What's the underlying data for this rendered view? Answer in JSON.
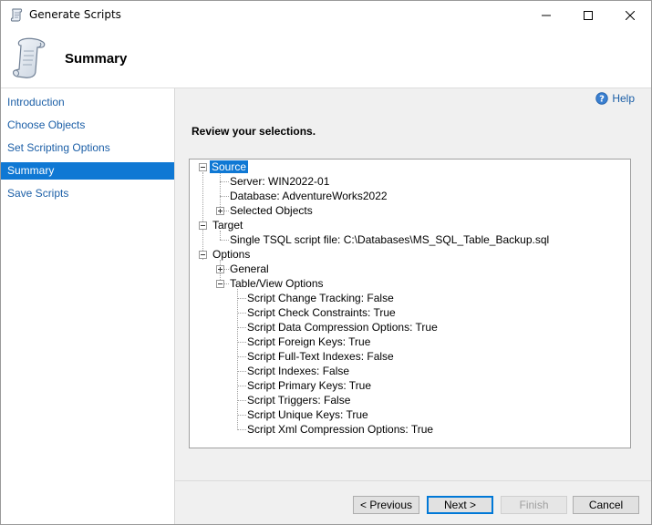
{
  "window": {
    "title": "Generate Scripts",
    "icon": "scroll-icon"
  },
  "header": {
    "title": "Summary"
  },
  "nav": {
    "items": [
      {
        "label": "Introduction",
        "selected": false
      },
      {
        "label": "Choose Objects",
        "selected": false
      },
      {
        "label": "Set Scripting Options",
        "selected": false
      },
      {
        "label": "Summary",
        "selected": true
      },
      {
        "label": "Save Scripts",
        "selected": false
      }
    ]
  },
  "help": {
    "label": "Help"
  },
  "main": {
    "review_label": "Review your selections."
  },
  "tree": {
    "source": {
      "label": "Source",
      "server": "Server: WIN2022-01",
      "database": "Database: AdventureWorks2022",
      "selected_objects": "Selected Objects"
    },
    "target": {
      "label": "Target",
      "script_file": "Single TSQL script file: C:\\Databases\\MS_SQL_Table_Backup.sql"
    },
    "options": {
      "label": "Options",
      "general": "General",
      "table_view": "Table/View Options",
      "items": [
        "Script Change Tracking: False",
        "Script Check Constraints: True",
        "Script Data Compression Options: True",
        "Script Foreign Keys: True",
        "Script Full-Text Indexes: False",
        "Script Indexes: False",
        "Script Primary Keys: True",
        "Script Triggers: False",
        "Script Unique Keys: True",
        "Script Xml Compression Options: True"
      ]
    }
  },
  "footer": {
    "previous": "< Previous",
    "next": "Next >",
    "finish": "Finish",
    "cancel": "Cancel"
  },
  "colors": {
    "accent": "#0f78d4",
    "link": "#1c5fa7"
  }
}
